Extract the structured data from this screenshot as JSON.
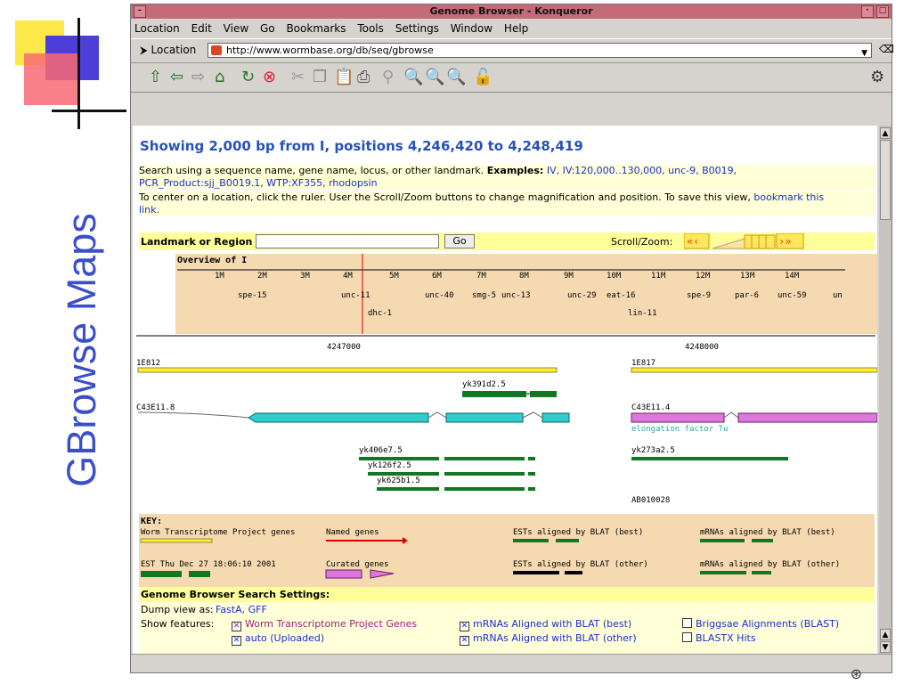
{
  "slide": {
    "title": "GBrowse Maps"
  },
  "window": {
    "title": "Genome Browser - Konqueror"
  },
  "menu": [
    "Location",
    "Edit",
    "View",
    "Go",
    "Bookmarks",
    "Tools",
    "Settings",
    "Window",
    "Help"
  ],
  "location": {
    "label": "Location",
    "url": "http://www.wormbase.org/db/seq/gbrowse"
  },
  "toolbar": {
    "icons": [
      "up-icon",
      "back-icon",
      "forward-icon",
      "home-icon",
      "reload-icon",
      "stop-icon",
      "cut-icon",
      "copy-icon",
      "paste-icon",
      "print-icon",
      "find-icon",
      "zoom-in-icon",
      "zoom-out-icon",
      "zoom-fit-icon",
      "lock-icon"
    ]
  },
  "page": {
    "heading": "Showing 2,000 bp from I, positions 4,246,420 to 4,248,419",
    "help1_prefix": "Search using a sequence name, gene name, locus, or other landmark.",
    "help1_examples_label": "Examples:",
    "help1_examples": "IV, IV:120,000..130,000, unc-9, B0019,",
    "help1_examples2": "PCR_Product:sjj_B0019.1, WTP:XF355, rhodopsin",
    "help2": "To center on a location, click the ruler. User the Scroll/Zoom buttons to change magnification and position. To save this view,",
    "help2_link": "bookmark this",
    "help2_link2": "link.",
    "landmark_label": "Landmark or Region",
    "go_label": "Go",
    "scroll_zoom_label": "Scroll/Zoom:"
  },
  "overview": {
    "title": "Overview of I",
    "ticks": [
      "1M",
      "2M",
      "3M",
      "4M",
      "5M",
      "6M",
      "7M",
      "8M",
      "9M",
      "10M",
      "11M",
      "12M",
      "13M",
      "14M"
    ],
    "genes_row1": [
      "spe-15",
      "unc-11",
      "unc-40",
      "smg-5",
      "unc-13",
      "unc-29",
      "eat-16",
      "spe-9",
      "par-6",
      "unc-59",
      "un"
    ],
    "genes_row2": [
      "dhc-1",
      "lin-11"
    ]
  },
  "detail": {
    "ruler_labels": [
      "4247000",
      "4248000"
    ],
    "features": [
      "1E812",
      "1E817",
      "yk391d2.5",
      "C43E11.8",
      "C43E11.4",
      "elongation factor Tu",
      "yk406e7.5",
      "yk273a2.5",
      "yk126f2.5",
      "yk625b1.5",
      "AB010028"
    ]
  },
  "key": {
    "title": "KEY:",
    "items": [
      "Worm Transcriptome Project genes",
      "Named genes",
      "ESTs aligned by BLAT (best)",
      "mRNAs aligned by BLAT (best)",
      "EST Thu Dec 27 18:06:10 2001",
      "Curated genes",
      "ESTs aligned by BLAT (other)",
      "mRNAs aligned by BLAT (other)"
    ]
  },
  "settings": {
    "title": "Genome Browser Search Settings:",
    "dump_label": "Dump view as:",
    "dump_links": "FastA, GFF",
    "show_label": "Show features:",
    "features": [
      {
        "label": "Worm Transcriptome Project Genes",
        "checked": true
      },
      {
        "label": "mRNAs Aligned with BLAT (best)",
        "checked": true
      },
      {
        "label": "Briggsae Alignments (BLAST)",
        "checked": false
      },
      {
        "label": "auto (Uploaded)",
        "checked": true
      },
      {
        "label": "mRNAs Aligned with BLAT (other)",
        "checked": true
      },
      {
        "label": "BLASTX Hits",
        "checked": false
      }
    ]
  },
  "colors": {
    "heading": "#2851b8",
    "overview_bg": "#f5d9b0",
    "help_bg": "#ffffd8",
    "titlebar": "#c46a78"
  }
}
